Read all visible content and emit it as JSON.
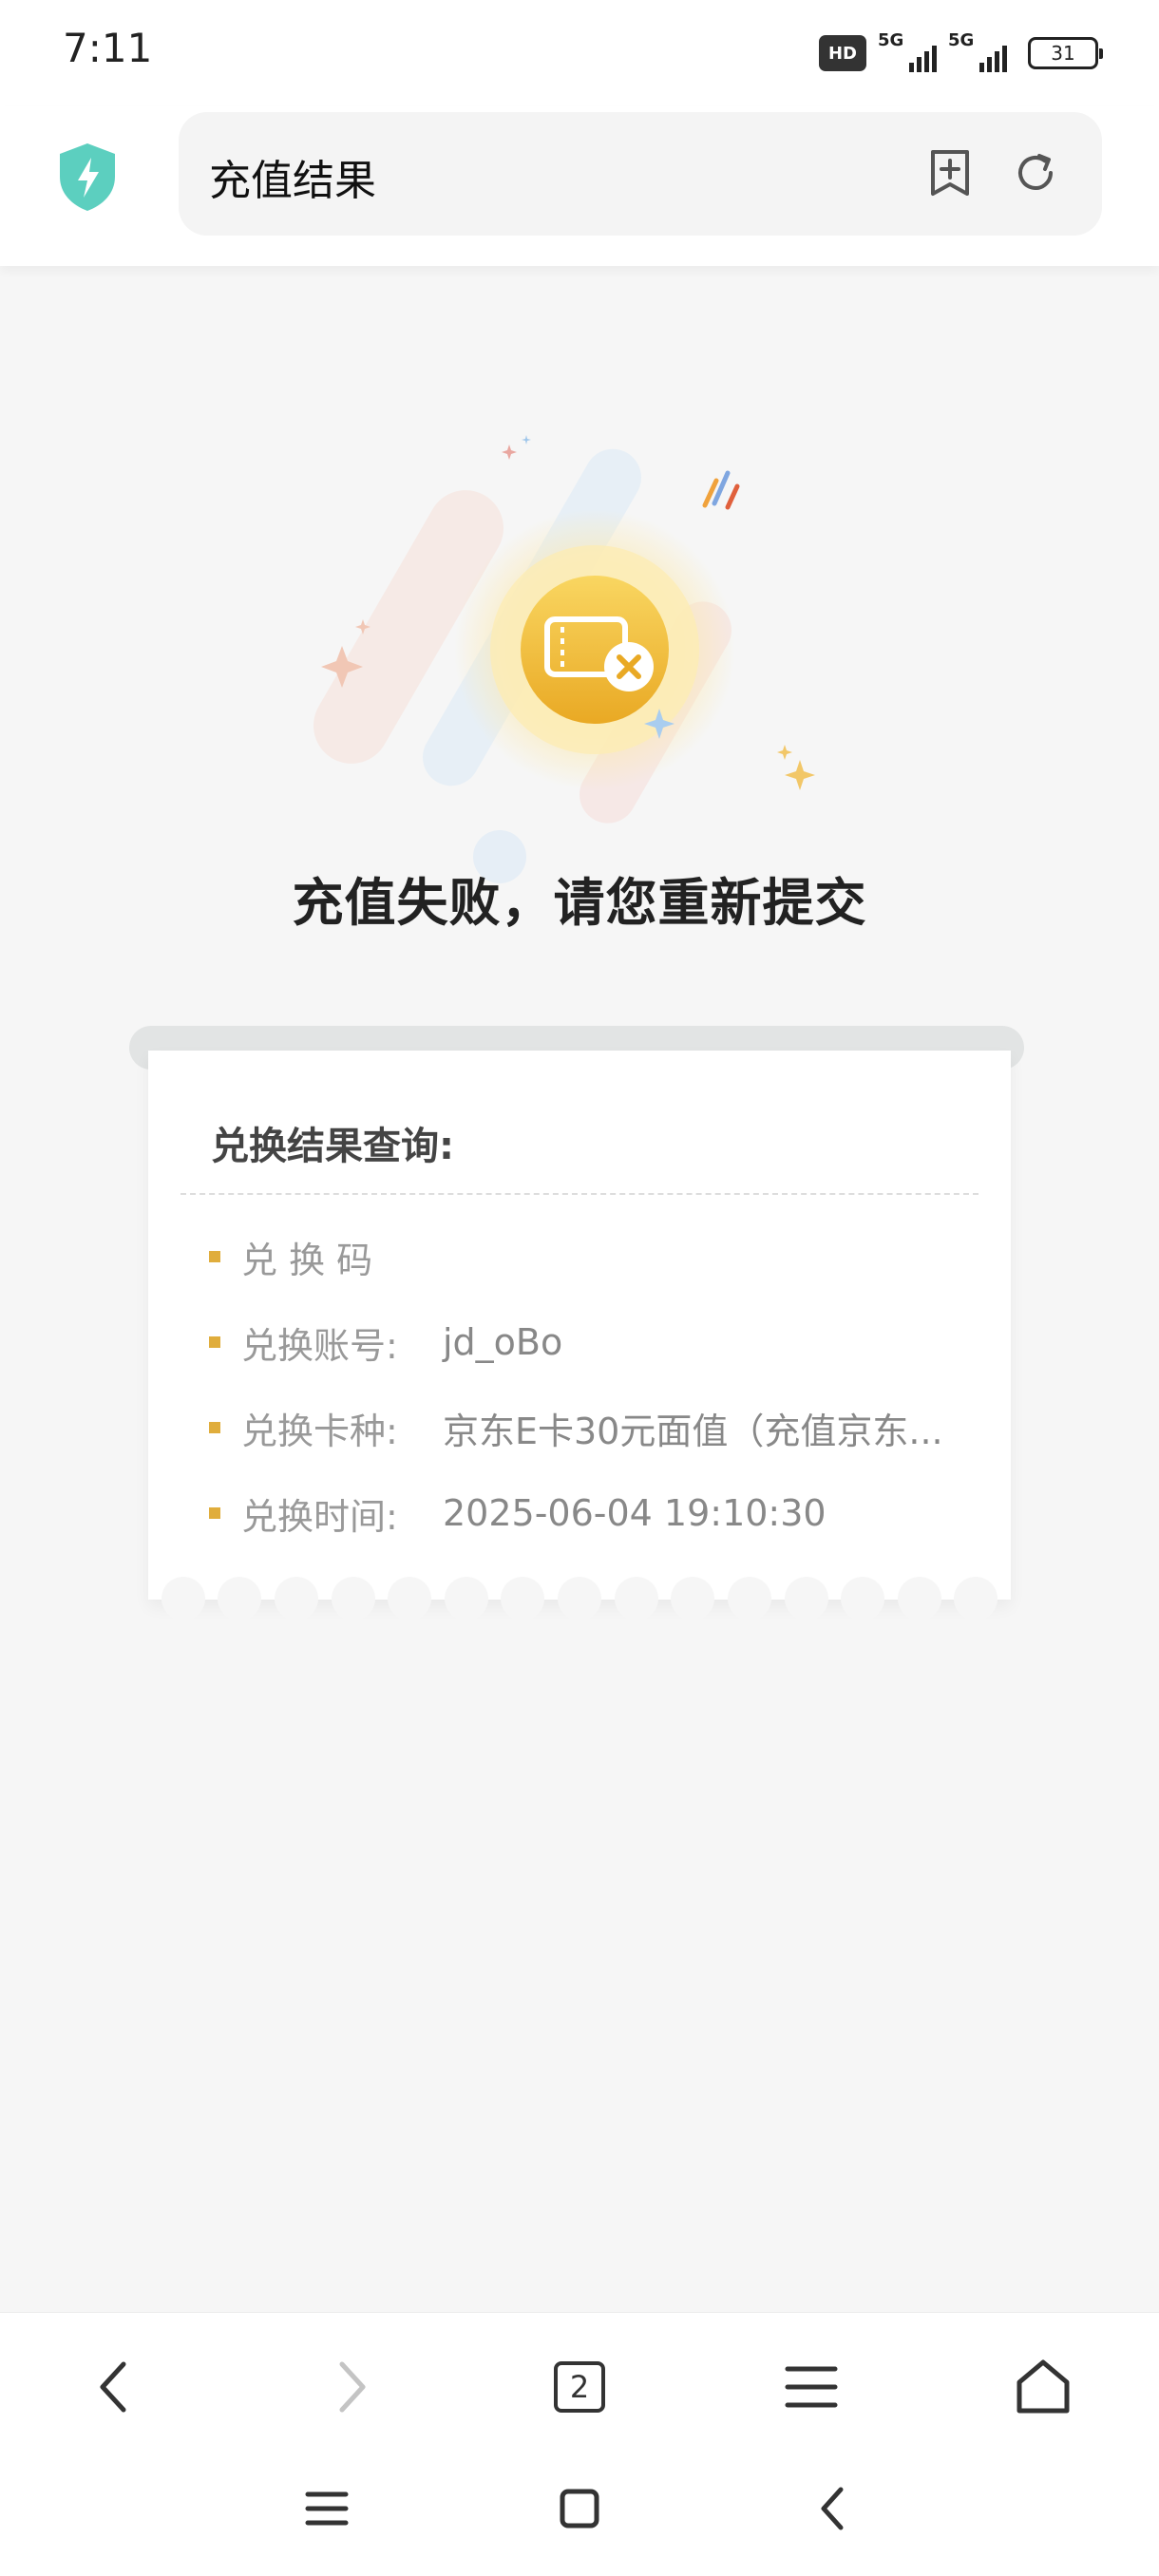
{
  "status_bar": {
    "time": "7:11",
    "hd_label": "HD",
    "network_1": "5G",
    "network_2": "5G",
    "battery": "31"
  },
  "browser": {
    "page_title": "充值结果",
    "shield_icon": "shield-bolt-icon",
    "bookmark_icon": "bookmark-add-icon",
    "refresh_icon": "refresh-icon"
  },
  "result": {
    "title": "充值失败，请您重新提交",
    "illustration": "ticket-failed-icon"
  },
  "card": {
    "title": "兑换结果查询:",
    "rows": [
      {
        "label": "兑 换 码",
        "value": ""
      },
      {
        "label": "兑换账号:",
        "value": "jd_oBo"
      },
      {
        "label": "兑换卡种:",
        "value": "京东E卡30元面值（充值京东..."
      },
      {
        "label": "兑换时间:",
        "value": "2025-06-04 19:10:30"
      }
    ]
  },
  "bottom_nav": {
    "tab_count": "2",
    "back_icon": "chevron-left-icon",
    "forward_icon": "chevron-right-icon",
    "menu_icon": "menu-icon",
    "home_icon": "home-icon"
  },
  "colors": {
    "accent_teal": "#5ccfbf",
    "bullet_gold": "#e0ad3c",
    "coin_gold": "#f2bf3a"
  }
}
